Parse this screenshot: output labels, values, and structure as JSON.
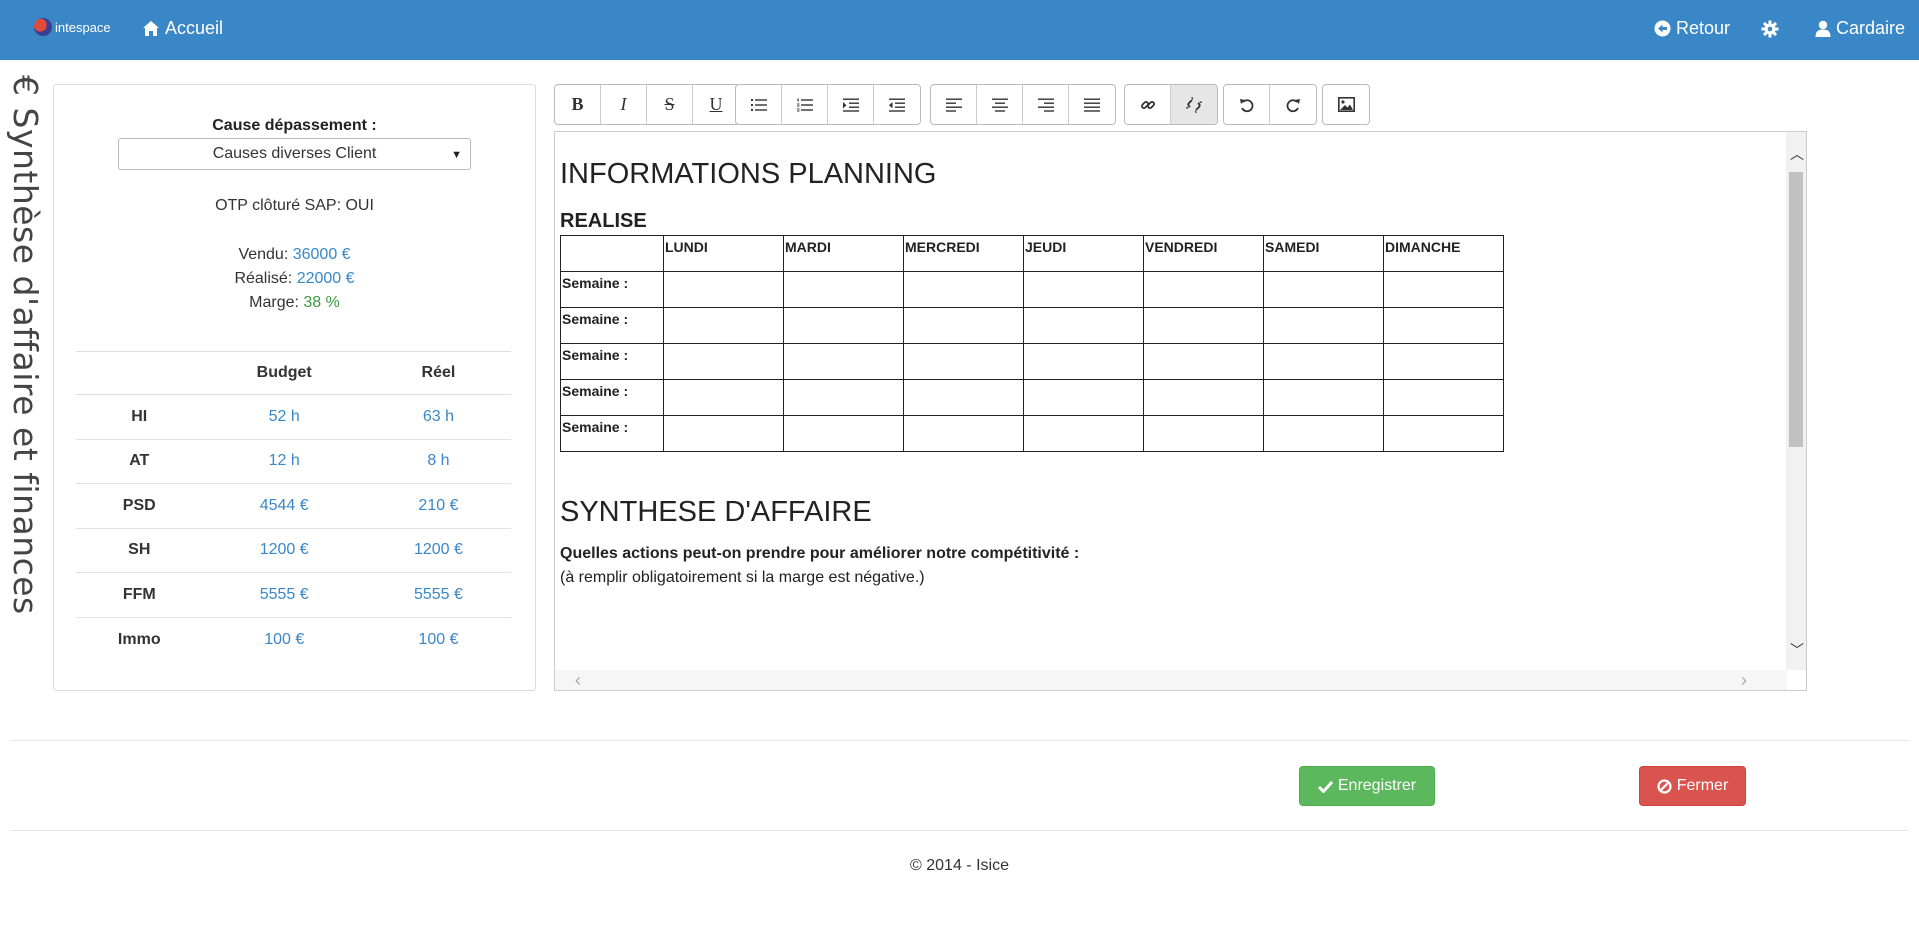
{
  "navbar": {
    "brand": "intespace",
    "home": "Accueil",
    "back": "Retour",
    "user": "Cardaire"
  },
  "page_title": "Synthèse d'affaire et finances",
  "page_title_icon": "€",
  "panel": {
    "cause_label": "Cause dépassement :",
    "cause_value": "Causes diverses Client",
    "otp": "OTP clôturé SAP: OUI",
    "vendu_label": "Vendu:",
    "vendu_value": "36000 €",
    "realise_label": "Réalisé:",
    "realise_value": "22000 €",
    "marge_label": "Marge:",
    "marge_value": "38 %",
    "table": {
      "headers": [
        "",
        "Budget",
        "Réel"
      ],
      "rows": [
        {
          "label": "HI",
          "budget": "52 h",
          "reel": "63 h"
        },
        {
          "label": "AT",
          "budget": "12 h",
          "reel": "8 h"
        },
        {
          "label": "PSD",
          "budget": "4544 €",
          "reel": "210 €"
        },
        {
          "label": "SH",
          "budget": "1200 €",
          "reel": "1200 €"
        },
        {
          "label": "FFM",
          "budget": "5555 €",
          "reel": "5555 €"
        },
        {
          "label": "Immo",
          "budget": "100 €",
          "reel": "100 €"
        }
      ]
    }
  },
  "toolbar": {
    "bold": "B",
    "italic": "I",
    "strike": "S",
    "underline": "U"
  },
  "editor": {
    "heading_planning": "INFORMATIONS PLANNING",
    "heading_realise": "REALISE",
    "days": [
      "LUNDI",
      "MARDI",
      "MERCREDI",
      "JEUDI",
      "VENDREDI",
      "SAMEDI",
      "DIMANCHE"
    ],
    "week_label": "Semaine :",
    "heading_synthese": "SYNTHESE D'AFFAIRE",
    "question_actions": "Quelles actions peut-on prendre pour améliorer notre compétitivité :",
    "question_note": "(à remplir obligatoirement si la marge est négative.)"
  },
  "buttons": {
    "save": "Enregistrer",
    "close": "Fermer"
  },
  "footer": {
    "copyright": "© 2014 - Isice"
  },
  "colors": {
    "navbar": "#3a87c8",
    "link_blue": "#3a87c8",
    "marge_green": "#3c9a3c",
    "save_green": "#5cb85c",
    "close_red": "#d9534f"
  }
}
